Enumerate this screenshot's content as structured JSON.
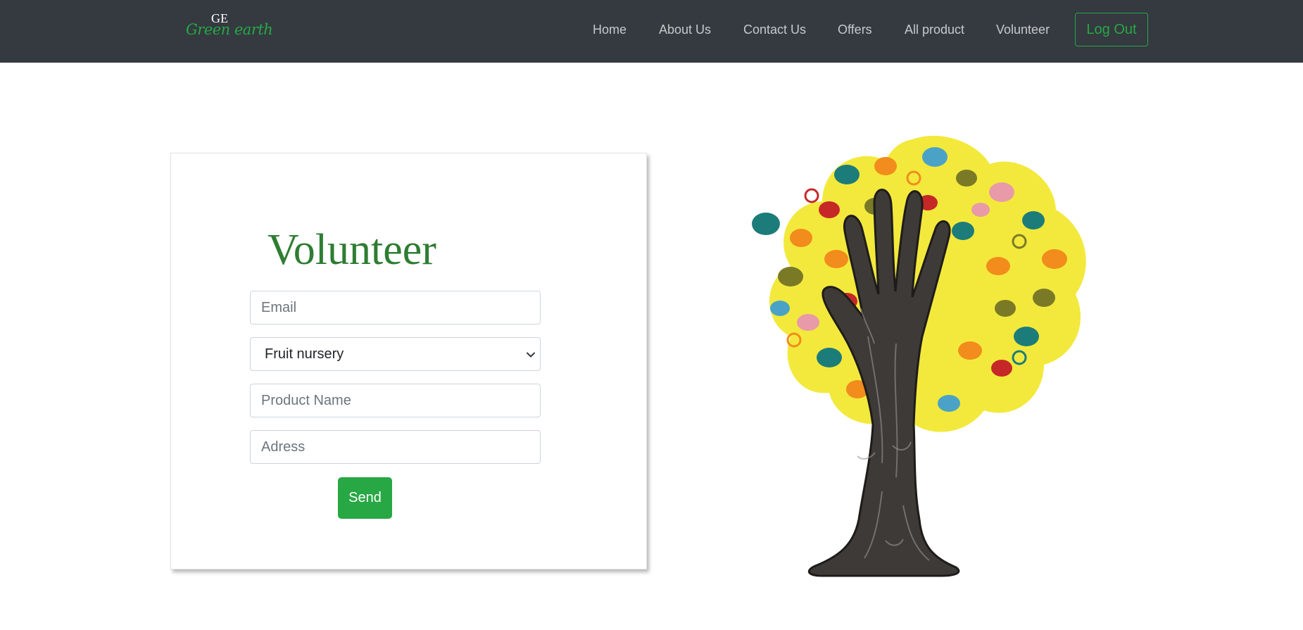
{
  "brand": {
    "mark": "GE",
    "name": "Green earth"
  },
  "nav": {
    "links": [
      "Home",
      "About Us",
      "Contact Us",
      "Offers",
      "All product",
      "Volunteer"
    ],
    "logout_label": "Log Out"
  },
  "form": {
    "title": "Volunteer",
    "email_placeholder": "Email",
    "category_selected": "Fruit nursery",
    "product_placeholder": "Product Name",
    "address_placeholder": "Adress",
    "send_label": "Send"
  },
  "illustration": {
    "icon": "hand-tree-icon"
  },
  "colors": {
    "navbar": "#343a40",
    "accent": "#28a745",
    "title": "#2e7d32",
    "tree_foliage": "#f3e93c",
    "trunk": "#3d3a37"
  }
}
